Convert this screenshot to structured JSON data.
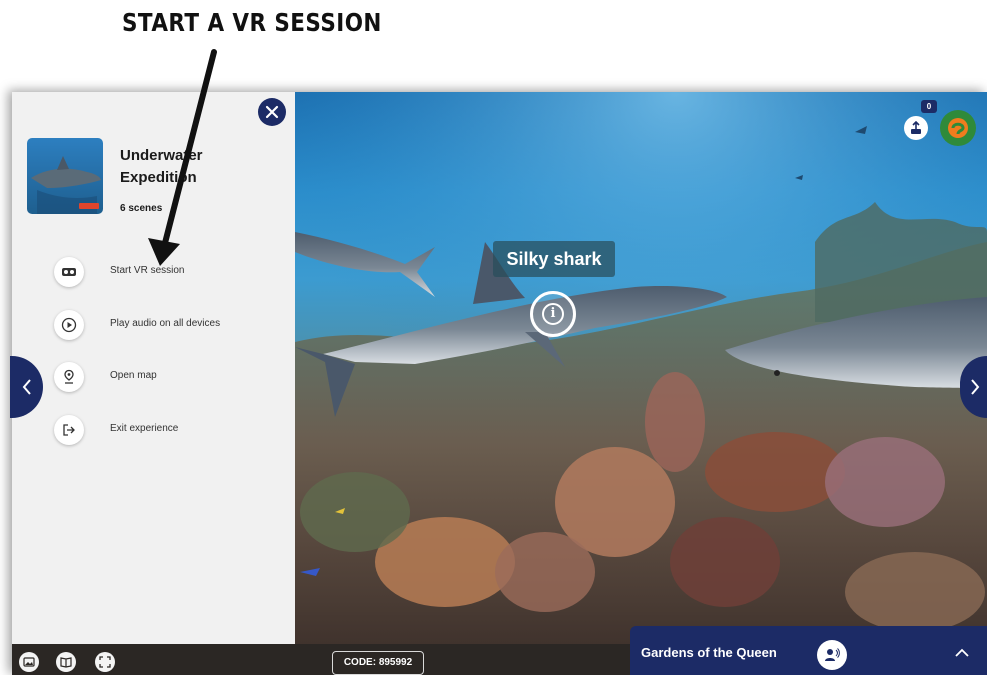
{
  "annotation": {
    "title": "START A VR SESSION"
  },
  "experience": {
    "title": "Underwater Expedition",
    "scene_count": "6 scenes"
  },
  "menu": [
    {
      "label": "Start VR session",
      "icon": "vr-headset-icon"
    },
    {
      "label": "Play audio on all devices",
      "icon": "play-icon"
    },
    {
      "label": "Open map",
      "icon": "map-pin-icon"
    },
    {
      "label": "Exit experience",
      "icon": "exit-icon"
    }
  ],
  "hotspot": {
    "label": "Silky shark",
    "icon_glyph": "i"
  },
  "top_right": {
    "badge_count": "0"
  },
  "bottom": {
    "code": "CODE: 895992",
    "scene_name": "Gardens of the Queen"
  },
  "colors": {
    "accent_navy": "#1c2b66",
    "panel_bg": "#f1f1f1",
    "bar_dark": "#2b2724",
    "avatar_green": "#2f8a3a",
    "avatar_orange": "#f07c1e"
  }
}
